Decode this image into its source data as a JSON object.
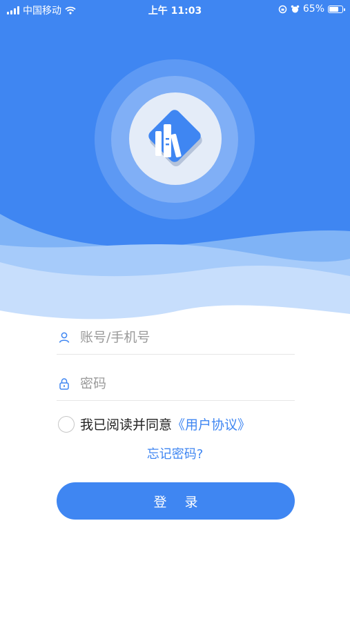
{
  "status_bar": {
    "carrier": "中国移动",
    "time": "上午 11:03",
    "battery": "65%"
  },
  "login": {
    "account_placeholder": "账号/手机号",
    "password_placeholder": "密码",
    "agree_text": "我已阅读并同意",
    "agreement_link": "《用户协议》",
    "forgot_password": "忘记密码?",
    "login_button": "登 录"
  },
  "colors": {
    "primary": "#3f86f2",
    "wave_light": "#bcd8fb",
    "wave_mid": "#8ebdf8"
  },
  "icons": {
    "app_logo": "books-icon",
    "account": "user-icon",
    "password": "lock-icon"
  }
}
